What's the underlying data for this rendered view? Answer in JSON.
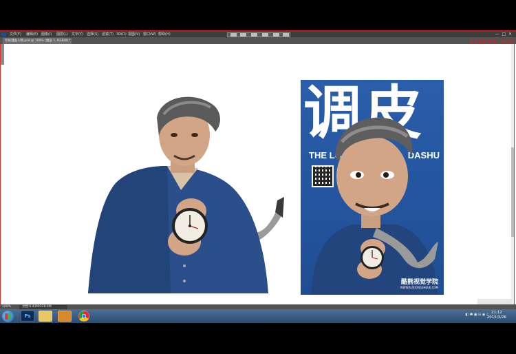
{
  "menubar": {
    "items": [
      "文件(F)",
      "编辑(E)",
      "图像(I)",
      "图层(L)",
      "文字(Y)",
      "选择(S)",
      "滤镜(T)",
      "3D(D)",
      "视图(V)",
      "窗口(W)",
      "帮助(H)"
    ]
  },
  "tab": {
    "label": "夸张漫画人物.psd @ 100% (图层 1, RGB/8) *"
  },
  "note": "更多视频专栏：米拉手",
  "status": {
    "zoom": "100%",
    "doc": "文档:6.41M/228.4M"
  },
  "poster": {
    "title": "调皮",
    "subtitle_left": "THE LO",
    "subtitle_right": "DASHU",
    "brand": "酷熊视觉学院",
    "brand_url": "WWW.KUXIONGSHIJUE.COM"
  },
  "taskbar": {
    "apps": [
      "start-icon",
      "photoshop-icon",
      "folder-icon",
      "bear-icon",
      "chrome-icon"
    ],
    "time": "21:12",
    "date": "2015/3/26"
  },
  "colors": {
    "poster_bg": "#2a5eab",
    "accent_red": "#d33"
  }
}
